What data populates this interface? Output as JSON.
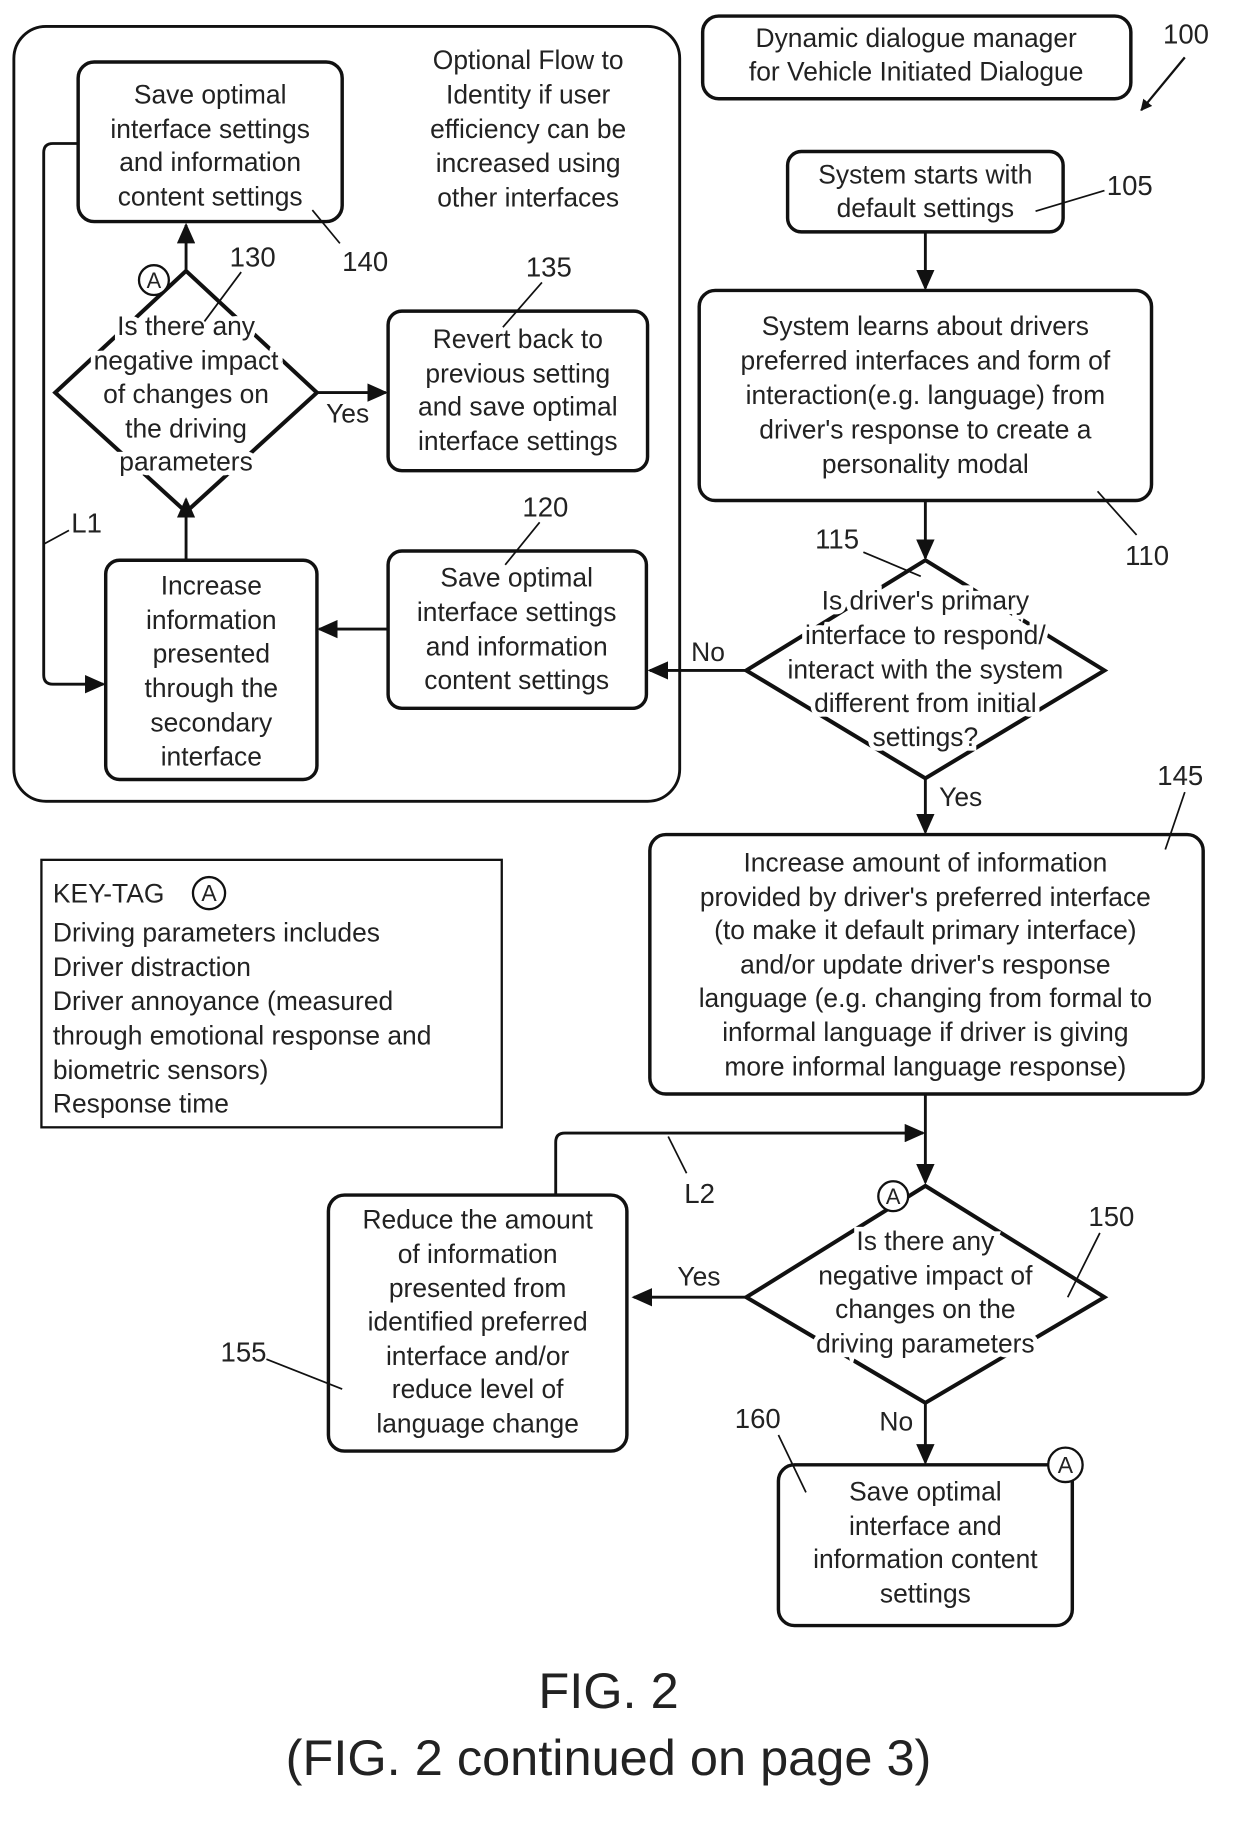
{
  "title": [
    "Dynamic dialogue manager",
    "for Vehicle Initiated Dialogue"
  ],
  "refs": {
    "r100": "100",
    "r105": "105",
    "r110": "110",
    "r115": "115",
    "r120": "120",
    "r130": "130",
    "r135": "135",
    "r140": "140",
    "r145": "145",
    "r150": "150",
    "r155": "155",
    "r160": "160",
    "L1": "L1",
    "L2": "L2"
  },
  "optional_flow_note": [
    "Optional Flow to",
    "Identity if user",
    "efficiency can be",
    "increased using",
    "other interfaces"
  ],
  "nodes": {
    "n105": [
      "System starts with",
      "default settings"
    ],
    "n110": [
      "System learns about drivers",
      "preferred interfaces and form of",
      "interaction(e.g. language) from",
      "driver's response to create a",
      "personality modal"
    ],
    "n115": [
      "Is driver's primary",
      "interface to respond/",
      "interact with the system",
      "different from initial",
      "settings?"
    ],
    "n120": [
      "Save optimal",
      "interface settings",
      "and information",
      "content settings"
    ],
    "n125": [
      "Increase",
      "information",
      "presented",
      "through the",
      "secondary",
      "interface"
    ],
    "n130": [
      "Is there any",
      "negative impact",
      "of changes on",
      "the driving",
      "parameters"
    ],
    "n135": [
      "Revert back to",
      "previous setting",
      "and save optimal",
      "interface settings"
    ],
    "n140": [
      "Save optimal",
      "interface settings",
      "and information",
      "content settings"
    ],
    "n145": [
      "Increase amount of information",
      "provided by driver's preferred interface",
      "(to make it default primary interface)",
      "and/or update driver's response",
      "language (e.g. changing from formal to",
      "informal language if driver is giving",
      "more informal language response)"
    ],
    "n150": [
      "Is there any",
      "negative impact of",
      "changes on the",
      "driving parameters"
    ],
    "n155": [
      "Reduce the amount",
      "of information",
      "presented from",
      "identified preferred",
      "interface and/or",
      "reduce level of",
      "language change"
    ],
    "n160": [
      "Save optimal",
      "interface and",
      "information content",
      "settings"
    ]
  },
  "edge_labels": {
    "yes": "Yes",
    "no": "No"
  },
  "tag_letter": "A",
  "key": {
    "heading": "KEY-TAG",
    "lines": [
      "Driving parameters includes",
      "Driver distraction",
      "Driver annoyance (measured",
      "through emotional response and",
      "biometric sensors)",
      "Response time"
    ]
  },
  "caption": [
    "FIG. 2",
    "(FIG. 2 continued on page 3)"
  ]
}
